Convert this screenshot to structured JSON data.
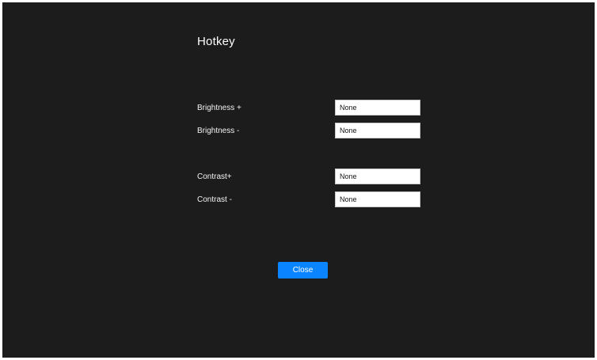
{
  "window": {
    "title": "Hotkey"
  },
  "hotkeys": [
    {
      "label": "Brightness +",
      "value": "None"
    },
    {
      "label": "Brightness -",
      "value": "None"
    },
    {
      "label": "Contrast+",
      "value": "None"
    },
    {
      "label": "Contrast -",
      "value": "None"
    }
  ],
  "actions": {
    "close_label": "Close"
  },
  "colors": {
    "background": "#1c1c1c",
    "accent": "#0a84ff",
    "field_background": "#ffffff"
  }
}
